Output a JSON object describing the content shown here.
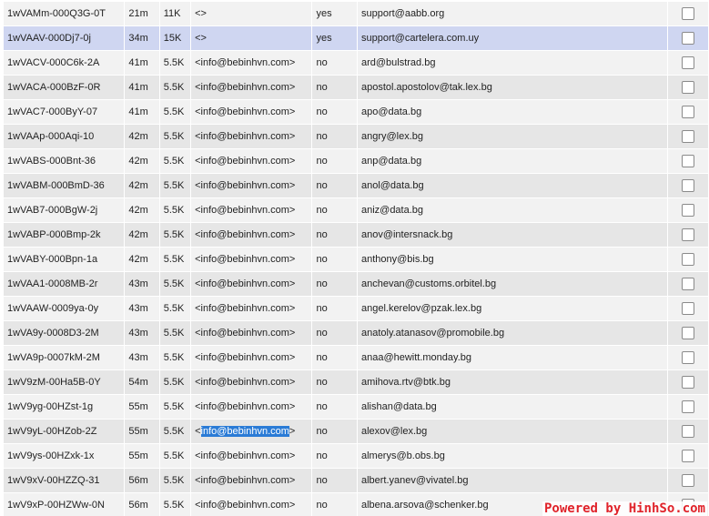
{
  "rows": [
    {
      "id": "1wVAMm-000Q3G-0T",
      "age": "21m",
      "size": "11K",
      "sender": "<>",
      "frozen": "yes",
      "recipient": "support@aabb.org"
    },
    {
      "id": "1wVAAV-000Dj7-0j",
      "age": "34m",
      "size": "15K",
      "sender": "<>",
      "frozen": "yes",
      "recipient": "support@cartelera.com.uy"
    },
    {
      "id": "1wVACV-000C6k-2A",
      "age": "41m",
      "size": "5.5K",
      "sender": "<info@bebinhvn.com>",
      "frozen": "no",
      "recipient": "ard@bulstrad.bg"
    },
    {
      "id": "1wVACA-000BzF-0R",
      "age": "41m",
      "size": "5.5K",
      "sender": "<info@bebinhvn.com>",
      "frozen": "no",
      "recipient": "apostol.apostolov@tak.lex.bg"
    },
    {
      "id": "1wVAC7-000ByY-07",
      "age": "41m",
      "size": "5.5K",
      "sender": "<info@bebinhvn.com>",
      "frozen": "no",
      "recipient": "apo@data.bg"
    },
    {
      "id": "1wVAAp-000Aqi-10",
      "age": "42m",
      "size": "5.5K",
      "sender": "<info@bebinhvn.com>",
      "frozen": "no",
      "recipient": "angry@lex.bg"
    },
    {
      "id": "1wVABS-000Bnt-36",
      "age": "42m",
      "size": "5.5K",
      "sender": "<info@bebinhvn.com>",
      "frozen": "no",
      "recipient": "anp@data.bg"
    },
    {
      "id": "1wVABM-000BmD-36",
      "age": "42m",
      "size": "5.5K",
      "sender": "<info@bebinhvn.com>",
      "frozen": "no",
      "recipient": "anol@data.bg"
    },
    {
      "id": "1wVAB7-000BgW-2j",
      "age": "42m",
      "size": "5.5K",
      "sender": "<info@bebinhvn.com>",
      "frozen": "no",
      "recipient": "aniz@data.bg"
    },
    {
      "id": "1wVABP-000Bmp-2k",
      "age": "42m",
      "size": "5.5K",
      "sender": "<info@bebinhvn.com>",
      "frozen": "no",
      "recipient": "anov@intersnack.bg"
    },
    {
      "id": "1wVABY-000Bpn-1a",
      "age": "42m",
      "size": "5.5K",
      "sender": "<info@bebinhvn.com>",
      "frozen": "no",
      "recipient": "anthony@bis.bg"
    },
    {
      "id": "1wVAA1-0008MB-2r",
      "age": "43m",
      "size": "5.5K",
      "sender": "<info@bebinhvn.com>",
      "frozen": "no",
      "recipient": "anchevan@customs.orbitel.bg"
    },
    {
      "id": "1wVAAW-0009ya-0y",
      "age": "43m",
      "size": "5.5K",
      "sender": "<info@bebinhvn.com>",
      "frozen": "no",
      "recipient": "angel.kerelov@pzak.lex.bg"
    },
    {
      "id": "1wVA9y-0008D3-2M",
      "age": "43m",
      "size": "5.5K",
      "sender": "<info@bebinhvn.com>",
      "frozen": "no",
      "recipient": "anatoly.atanasov@promobile.bg"
    },
    {
      "id": "1wVA9p-0007kM-2M",
      "age": "43m",
      "size": "5.5K",
      "sender": "<info@bebinhvn.com>",
      "frozen": "no",
      "recipient": "anaa@hewitt.monday.bg"
    },
    {
      "id": "1wV9zM-00Ha5B-0Y",
      "age": "54m",
      "size": "5.5K",
      "sender": "<info@bebinhvn.com>",
      "frozen": "no",
      "recipient": "amihova.rtv@btk.bg"
    },
    {
      "id": "1wV9yg-00HZst-1g",
      "age": "55m",
      "size": "5.5K",
      "sender": "<info@bebinhvn.com>",
      "frozen": "no",
      "recipient": "alishan@data.bg"
    },
    {
      "id": "1wV9yL-00HZob-2Z",
      "age": "55m",
      "size": "5.5K",
      "sender_prefix": "<",
      "sender_hl": "info@bebinhvn.com",
      "sender_suffix": ">",
      "frozen": "no",
      "recipient": "alexov@lex.bg"
    },
    {
      "id": "1wV9ys-00HZxk-1x",
      "age": "55m",
      "size": "5.5K",
      "sender": "<info@bebinhvn.com>",
      "frozen": "no",
      "recipient": "almerys@b.obs.bg"
    },
    {
      "id": "1wV9xV-00HZZQ-31",
      "age": "56m",
      "size": "5.5K",
      "sender": "<info@bebinhvn.com>",
      "frozen": "no",
      "recipient": "albert.yanev@vivatel.bg"
    },
    {
      "id": "1wV9xP-00HZWw-0N",
      "age": "56m",
      "size": "5.5K",
      "sender": "<info@bebinhvn.com>",
      "frozen": "no",
      "recipient": "albena.arsova@schenker.bg"
    }
  ],
  "watermark": "Powered by HinhSo.com"
}
